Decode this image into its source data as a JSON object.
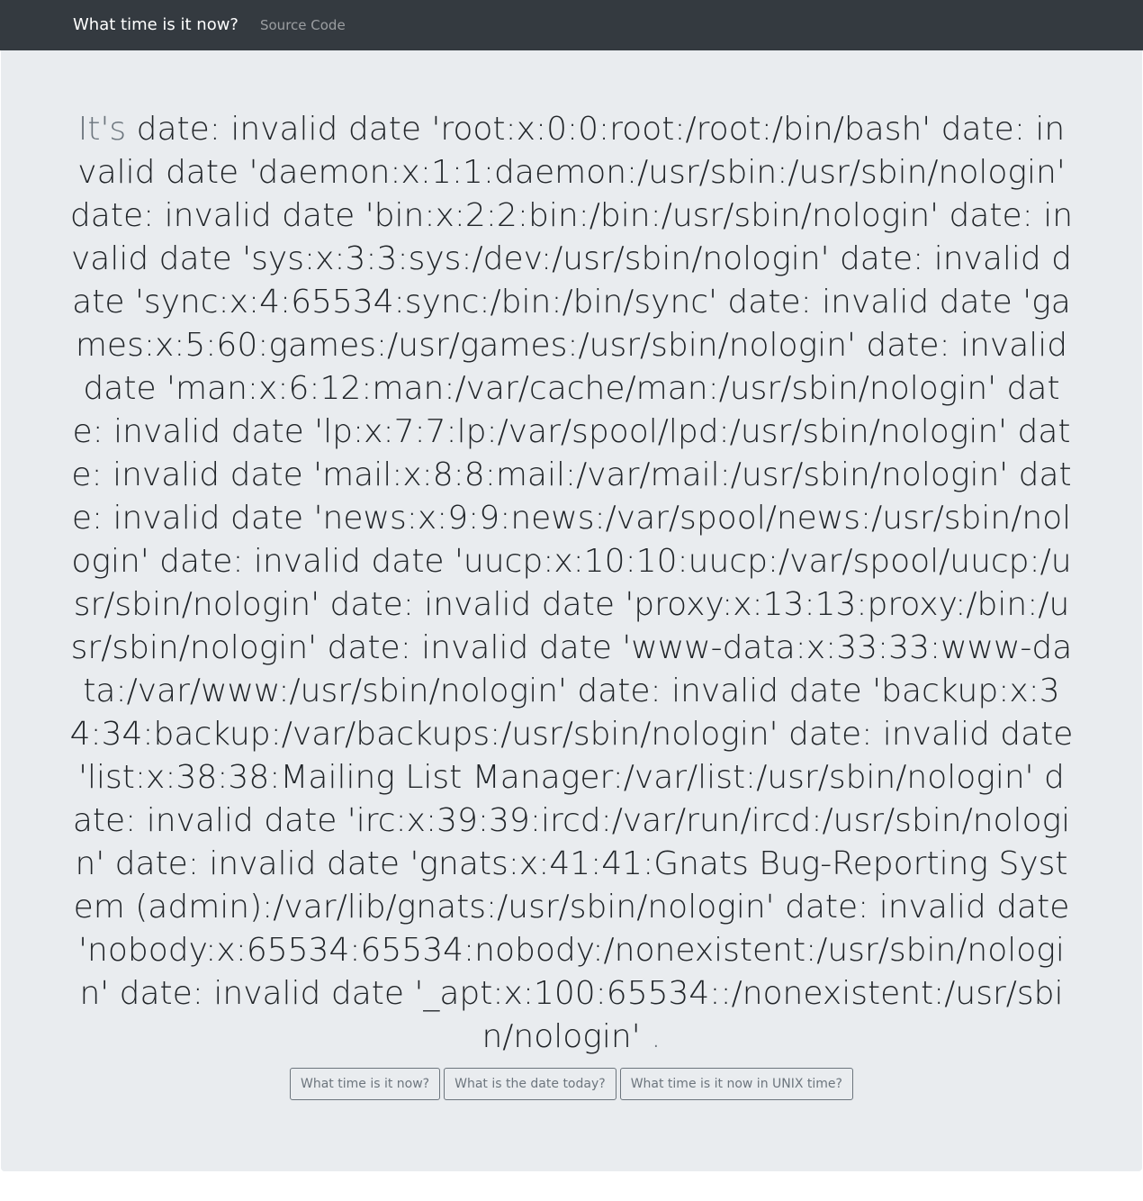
{
  "navbar": {
    "brand": "What time is it now?",
    "source_link": "Source Code"
  },
  "main": {
    "prefix": "It's",
    "output": "date: invalid date 'root:x:0:0:root:/root:/bin/bash' date: invalid date 'daemon:x:1:1:daemon:/usr/sbin:/usr/sbin/nologin' date: invalid date 'bin:x:2:2:bin:/bin:/usr/sbin/nologin' date: invalid date 'sys:x:3:3:sys:/dev:/usr/sbin/nologin' date: invalid date 'sync:x:4:65534:sync:/bin:/bin/sync' date: invalid date 'games:x:5:60:games:/usr/games:/usr/sbin/nologin' date: invalid date 'man:x:6:12:man:/var/cache/man:/usr/sbin/nologin' date: invalid date 'lp:x:7:7:lp:/var/spool/lpd:/usr/sbin/nologin' date: invalid date 'mail:x:8:8:mail:/var/mail:/usr/sbin/nologin' date: invalid date 'news:x:9:9:news:/var/spool/news:/usr/sbin/nologin' date: invalid date 'uucp:x:10:10:uucp:/var/spool/uucp:/usr/sbin/nologin' date: invalid date 'proxy:x:13:13:proxy:/bin:/usr/sbin/nologin' date: invalid date 'www-data:x:33:33:www-data:/var/www:/usr/sbin/nologin' date: invalid date 'backup:x:34:34:backup:/var/backups:/usr/sbin/nologin' date: invalid date 'list:x:38:38:Mailing List Manager:/var/list:/usr/sbin/nologin' date: invalid date 'irc:x:39:39:ircd:/var/run/ircd:/usr/sbin/nologin' date: invalid date 'gnats:x:41:41:Gnats Bug-Reporting System (admin):/var/lib/gnats:/usr/sbin/nologin' date: invalid date 'nobody:x:65534:65534:nobody:/nonexistent:/usr/sbin/nologin' date: invalid date '_apt:x:100:65534::/nonexistent:/usr/sbin/nologin'",
    "suffix": "."
  },
  "buttons": {
    "time": "What time is it now?",
    "date": "What is the date today?",
    "unix": "What time is it now in UNIX time?"
  },
  "colors": {
    "navbar_bg": "#343a40",
    "jumbotron_bg": "#e9ecef",
    "muted_text": "#6c757d"
  }
}
